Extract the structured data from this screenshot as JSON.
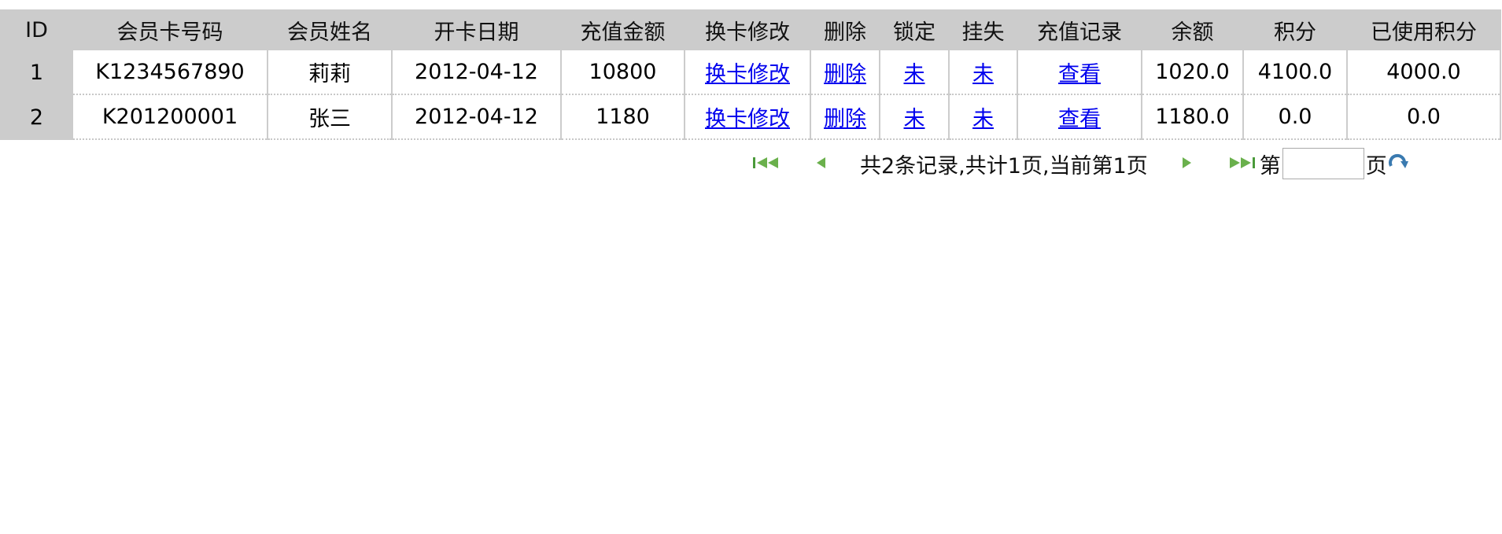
{
  "columns": [
    "ID",
    "会员卡号码",
    "会员姓名",
    "开卡日期",
    "充值金额",
    "换卡修改",
    "删除",
    "锁定",
    "挂失",
    "充值记录",
    "余额",
    "积分",
    "已使用积分"
  ],
  "rows": [
    {
      "id": "1",
      "card": "K1234567890",
      "name": "莉莉",
      "date": "2012-04-12",
      "recharge": "10800",
      "change": "换卡修改",
      "delete": "删除",
      "lock": "未",
      "loss": "未",
      "records": "查看",
      "balance": "1020.0",
      "points": "4100.0",
      "used": "4000.0"
    },
    {
      "id": "2",
      "card": "K201200001",
      "name": "张三",
      "date": "2012-04-12",
      "recharge": "1180",
      "change": "换卡修改",
      "delete": "删除",
      "lock": "未",
      "loss": "未",
      "records": "查看",
      "balance": "1180.0",
      "points": "0.0",
      "used": "0.0"
    }
  ],
  "pager": {
    "summary": "共2条记录,共计1页,当前第1页",
    "goto_prefix": "第",
    "goto_suffix": "页",
    "page_value": ""
  },
  "colors": {
    "header": "#cccccc",
    "link": "#0000ee",
    "pager_icon": "#4a9a3a"
  }
}
